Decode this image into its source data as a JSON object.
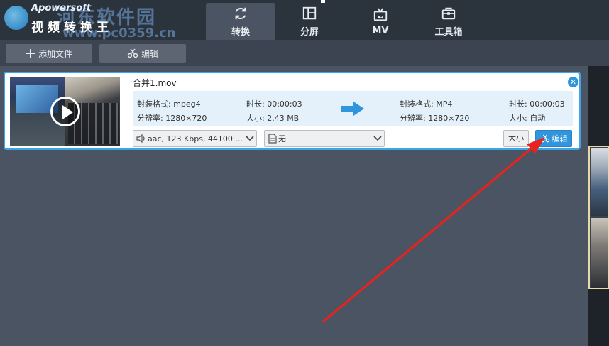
{
  "header": {
    "brand": "Apowersoft",
    "app_title": "视频转换王",
    "watermark_title": "河东软件园",
    "watermark_url": "www.pc0359.cn",
    "tabs": [
      {
        "label": "转换",
        "icon": "refresh-icon",
        "active": true
      },
      {
        "label": "分屏",
        "icon": "split-screen-icon",
        "active": false
      },
      {
        "label": "MV",
        "icon": "tv-icon",
        "active": false
      },
      {
        "label": "工具箱",
        "icon": "toolbox-icon",
        "active": false
      }
    ]
  },
  "toolbar": {
    "add_file_label": "添加文件",
    "edit_label": "编辑"
  },
  "file": {
    "name": "合并1.mov",
    "source": {
      "format_label": "封装格式: mpeg4",
      "duration_label": "时长: 00:00:03",
      "resolution_label": "分辨率: 1280×720",
      "size_label": "大小: 2.43 MB"
    },
    "target": {
      "format_label": "封装格式: MP4",
      "duration_label": "时长: 00:00:03",
      "resolution_label": "分辨率: 1280×720",
      "size_label": "大小: 自动"
    },
    "audio_select": "aac, 123 Kbps, 44100 ...",
    "subtitle_select": "无",
    "size_button": "大小",
    "edit_button": "编辑"
  },
  "colors": {
    "accent": "#2f95dd",
    "annotation": "#e8221c",
    "header_bg": "#2b333c",
    "body_bg": "#4a5462"
  }
}
